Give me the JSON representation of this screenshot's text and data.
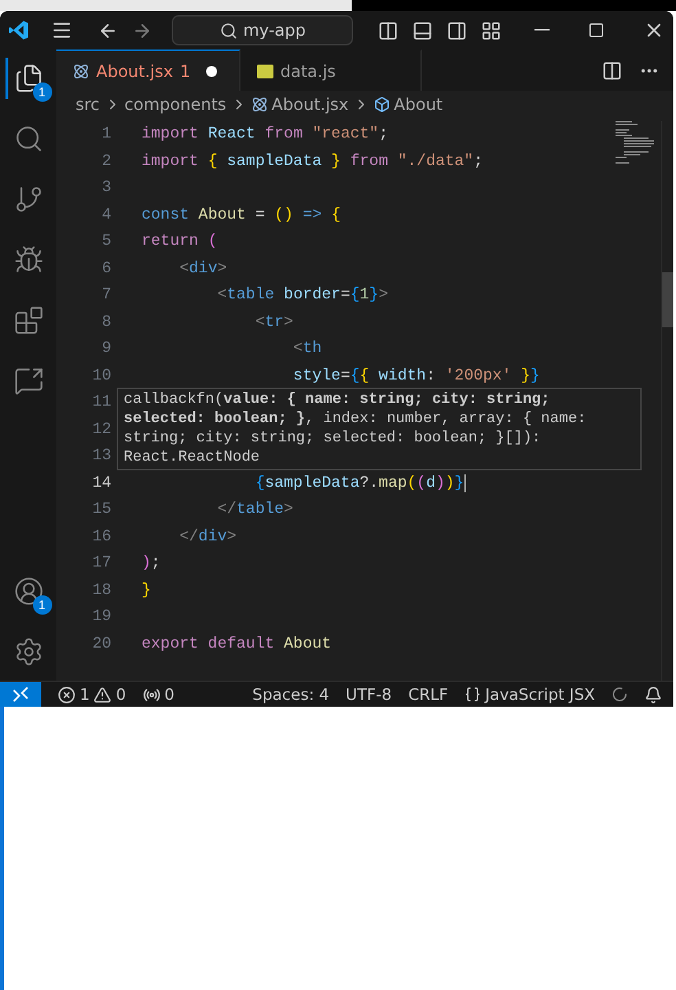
{
  "title_bar": {
    "search": "my-app"
  },
  "activity_bar": {
    "top": [
      {
        "kind": "explorer",
        "selected": true,
        "badge": "1"
      },
      {
        "kind": "search",
        "selected": false
      },
      {
        "kind": "source-control",
        "selected": false
      },
      {
        "kind": "debug",
        "selected": false
      },
      {
        "kind": "extensions",
        "selected": false
      },
      {
        "kind": "remote",
        "selected": false
      }
    ],
    "bottom": [
      {
        "kind": "account",
        "badge": "1"
      },
      {
        "kind": "settings"
      }
    ]
  },
  "tabs": [
    {
      "label": "About.jsx",
      "kind": "react",
      "problems": "1",
      "modified": true,
      "selected": true
    },
    {
      "label": "data.js",
      "kind": "js",
      "modified": false,
      "selected": false
    }
  ],
  "breadcrumbs": [
    {
      "label": "src",
      "kind": "folder"
    },
    {
      "label": "components",
      "kind": "folder"
    },
    {
      "label": "About.jsx",
      "kind": "react"
    },
    {
      "label": "About",
      "kind": "symbol"
    }
  ],
  "editor": {
    "lines": [
      {
        "number": "1",
        "current": false,
        "tokens": [
          {
            "kind": "kw",
            "text": "import "
          },
          {
            "kind": "var",
            "text": "React "
          },
          {
            "kind": "kw",
            "text": "from "
          },
          {
            "kind": "str",
            "text": "\"react\""
          },
          {
            "kind": "p",
            "text": ";"
          }
        ]
      },
      {
        "number": "2",
        "current": false,
        "tokens": [
          {
            "kind": "kw",
            "text": "import "
          },
          {
            "kind": "b1",
            "text": "{"
          },
          {
            "kind": "var",
            "text": " sampleData "
          },
          {
            "kind": "b1",
            "text": "} "
          },
          {
            "kind": "kw",
            "text": "from "
          },
          {
            "kind": "str",
            "text": "\"./data\""
          },
          {
            "kind": "p",
            "text": ";"
          }
        ]
      },
      {
        "number": "3",
        "current": false
      },
      {
        "number": "4",
        "current": false,
        "tokens": [
          {
            "kind": "st",
            "text": "const "
          },
          {
            "kind": "fn",
            "text": "About"
          },
          {
            "kind": "p",
            "text": " = "
          },
          {
            "kind": "b1",
            "text": "()"
          },
          {
            "kind": "st",
            "text": " => "
          },
          {
            "kind": "b1",
            "text": "{"
          }
        ]
      },
      {
        "number": "5",
        "current": false,
        "tokens": [
          {
            "kind": "kw",
            "text": "return "
          },
          {
            "kind": "b2",
            "text": "("
          }
        ]
      },
      {
        "number": "6",
        "current": false,
        "tokens": [
          {
            "kind": "tp",
            "text": "    <"
          },
          {
            "kind": "tag",
            "text": "div"
          },
          {
            "kind": "tp",
            "text": ">"
          }
        ]
      },
      {
        "number": "7",
        "current": false,
        "tokens": [
          {
            "kind": "tp",
            "text": "        <"
          },
          {
            "kind": "tag",
            "text": "table"
          },
          {
            "kind": "attr",
            "text": " border"
          },
          {
            "kind": "p",
            "text": "="
          },
          {
            "kind": "b3",
            "text": "{"
          },
          {
            "kind": "num",
            "text": "1"
          },
          {
            "kind": "b3",
            "text": "}"
          },
          {
            "kind": "tp",
            "text": ">"
          }
        ]
      },
      {
        "number": "8",
        "current": false,
        "tokens": [
          {
            "kind": "tp",
            "text": "            <"
          },
          {
            "kind": "tag",
            "text": "tr"
          },
          {
            "kind": "tp",
            "text": ">"
          }
        ]
      },
      {
        "number": "9",
        "current": false,
        "tokens": [
          {
            "kind": "tp",
            "text": "                <"
          },
          {
            "kind": "tag",
            "text": "th"
          }
        ]
      },
      {
        "number": "10",
        "current": false,
        "tokens": [
          {
            "kind": "attr",
            "text": "                style"
          },
          {
            "kind": "p",
            "text": "="
          },
          {
            "kind": "b3",
            "text": "{"
          },
          {
            "kind": "b1",
            "text": "{"
          },
          {
            "kind": "var",
            "text": " width"
          },
          {
            "kind": "p",
            "text": ": "
          },
          {
            "kind": "str",
            "text": "'200px' "
          },
          {
            "kind": "b1",
            "text": "}"
          },
          {
            "kind": "b3",
            "text": "}"
          }
        ]
      },
      {
        "number": "11",
        "current": false
      },
      {
        "number": "12",
        "current": false
      },
      {
        "number": "13",
        "current": false
      },
      {
        "number": "14",
        "current": true,
        "tokens": [
          {
            "kind": "b3",
            "text": "            {"
          },
          {
            "kind": "var",
            "text": "sampleData"
          },
          {
            "kind": "p",
            "text": "?."
          },
          {
            "kind": "fn",
            "text": "map"
          },
          {
            "kind": "b1",
            "text": "("
          },
          {
            "kind": "b2",
            "text": "("
          },
          {
            "kind": "var",
            "text": "d"
          },
          {
            "kind": "b2",
            "text": ")"
          },
          {
            "kind": "b1",
            "text": ")"
          },
          {
            "kind": "b3",
            "text": "}"
          }
        ]
      },
      {
        "number": "15",
        "current": false,
        "tokens": [
          {
            "kind": "tp",
            "text": "        </"
          },
          {
            "kind": "tag",
            "text": "table"
          },
          {
            "kind": "tp",
            "text": ">"
          }
        ]
      },
      {
        "number": "16",
        "current": false,
        "tokens": [
          {
            "kind": "tp",
            "text": "    </"
          },
          {
            "kind": "tag",
            "text": "div"
          },
          {
            "kind": "tp",
            "text": ">"
          }
        ]
      },
      {
        "number": "17",
        "current": false,
        "tokens": [
          {
            "kind": "b2",
            "text": ")"
          },
          {
            "kind": "p",
            "text": ";"
          }
        ]
      },
      {
        "number": "18",
        "current": false,
        "tokens": [
          {
            "kind": "b1",
            "text": "}"
          }
        ]
      },
      {
        "number": "19",
        "current": false
      },
      {
        "number": "20",
        "current": false,
        "tokens": [
          {
            "kind": "kw",
            "text": "export default "
          },
          {
            "kind": "fn",
            "text": "About"
          }
        ]
      }
    ],
    "hover": "callbackfn(**value: { name: string; city: string; selected: boolean; }**, index: number, array: { name: string; city: string; selected: boolean; }[]): React.ReactNode"
  },
  "status_bar": {
    "errors": "1",
    "warnings": "0",
    "ports": "0",
    "right": [
      {
        "kind": "text",
        "label": "Spaces: 4"
      },
      {
        "kind": "text",
        "label": "UTF-8"
      },
      {
        "kind": "text",
        "label": "CRLF"
      },
      {
        "kind": "language",
        "label": "JavaScript JSX"
      }
    ]
  }
}
